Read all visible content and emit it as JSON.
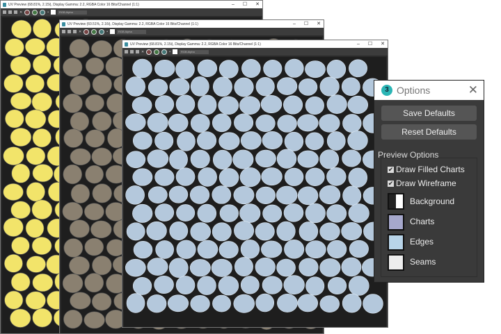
{
  "windows": [
    {
      "title": "UV Preview (68.81%, 2.15i), Display Gamma: 2.2, RGBA Color 16 Bits/Channel (1:1)",
      "channel": "RGB Alpha",
      "fill": "#f2e46a"
    },
    {
      "title": "UV Preview (60.51%, 2.16i), Display Gamma: 2.2, RGBA Color 16 Bits/Channel (1:1)",
      "channel": "RGB Alpha",
      "fill": "#8a8070"
    },
    {
      "title": "UV Preview (68.81%, 2.15i), Display Gamma: 2.2, RGBA Color 16 Bits/Channel (1:1)",
      "channel": "RGB Alpha",
      "fill": "#b4c8dc"
    }
  ],
  "options": {
    "title": "Options",
    "save_defaults": "Save Defaults",
    "reset_defaults": "Reset Defaults",
    "group_label": "Preview Options",
    "draw_filled_charts": {
      "label": "Draw Filled Charts",
      "checked": true
    },
    "draw_wireframe": {
      "label": "Draw Wireframe",
      "checked": true
    },
    "colors": [
      {
        "label": "Background",
        "color": "#222222"
      },
      {
        "label": "Charts",
        "color": "#a6a8cc"
      },
      {
        "label": "Edges",
        "color": "#b8d4e8"
      },
      {
        "label": "Seams",
        "color": "#eeeeee"
      }
    ]
  }
}
